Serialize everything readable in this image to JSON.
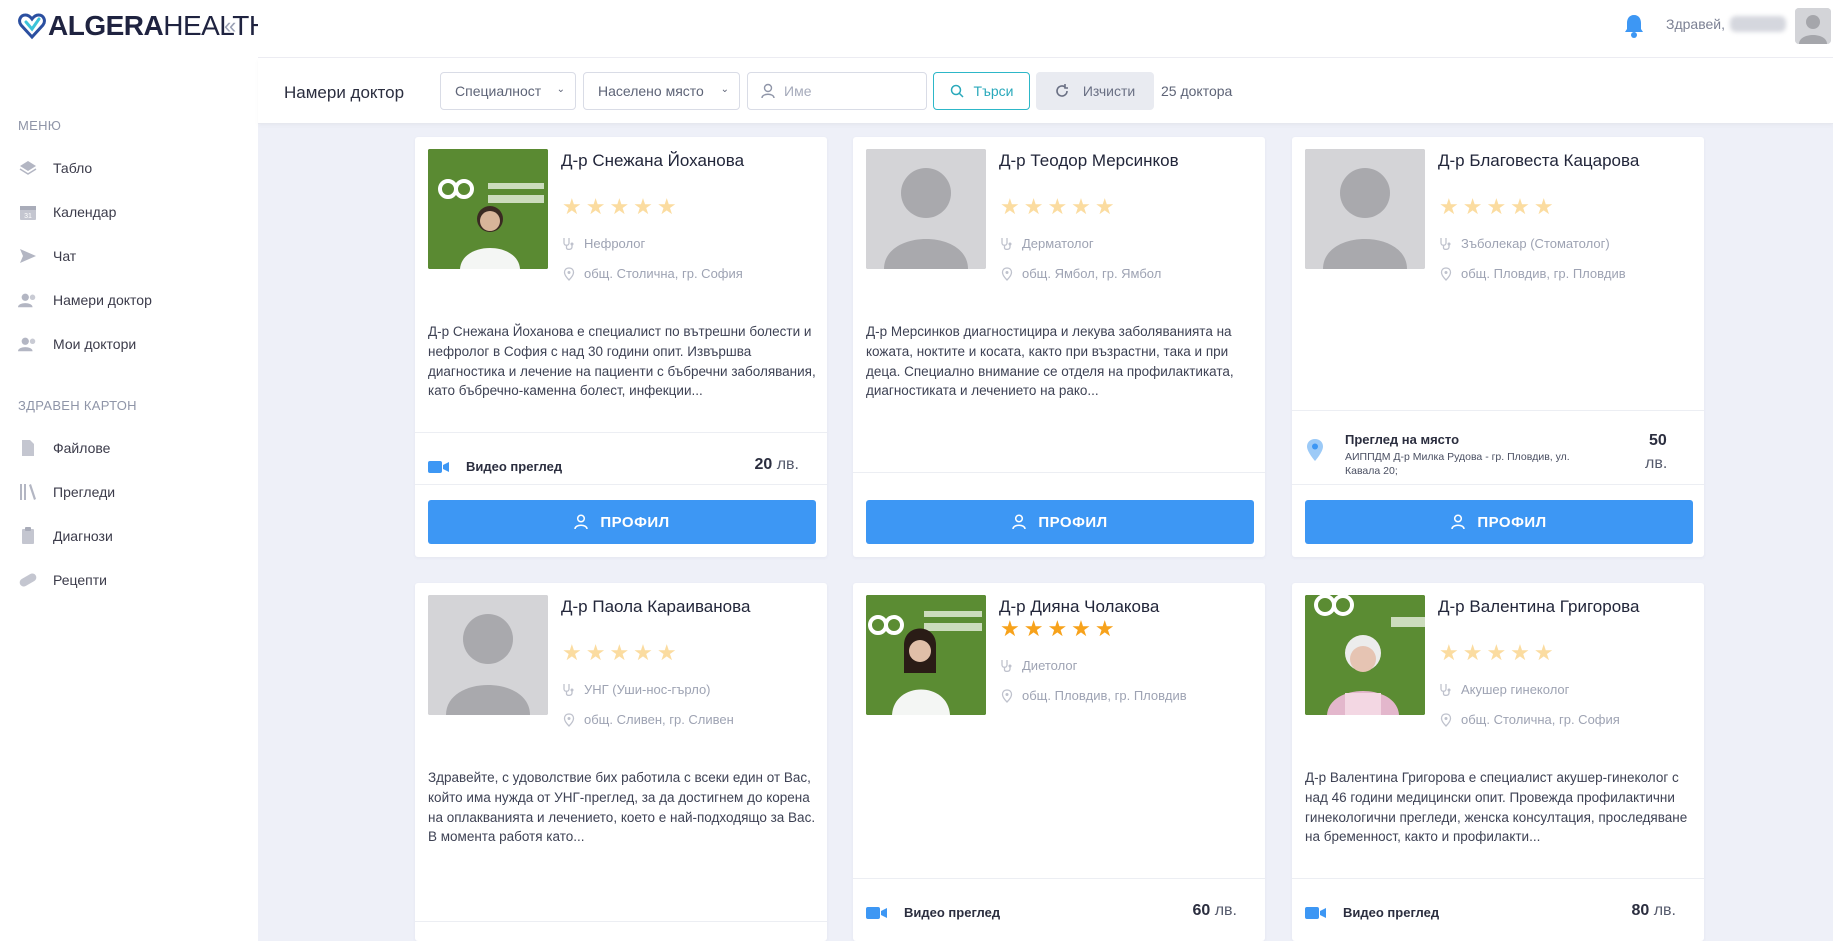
{
  "app": {
    "logo_bold": "ALGERA",
    "logo_light": "HEALTH",
    "collapse": "«"
  },
  "sidebar": {
    "section_menu": "МЕНЮ",
    "section_health": "ЗДРАВЕН КАРТОН",
    "items": [
      {
        "label": "Табло",
        "icon": "dashboard-icon"
      },
      {
        "label": "Календар",
        "icon": "calendar-icon"
      },
      {
        "label": "Чат",
        "icon": "send-icon"
      },
      {
        "label": "Намери доктор",
        "icon": "find-doctor-icon"
      },
      {
        "label": "Мои доктори",
        "icon": "my-doctors-icon"
      },
      {
        "label": "Файлове",
        "icon": "file-icon"
      },
      {
        "label": "Прегледи",
        "icon": "books-icon"
      },
      {
        "label": "Диагнози",
        "icon": "clipboard-icon"
      },
      {
        "label": "Рецепти",
        "icon": "pill-icon"
      }
    ]
  },
  "topbar": {
    "greeting": "Здравей,"
  },
  "filters": {
    "title": "Намери доктор",
    "specialty": "Специалност",
    "city": "Населено място",
    "name_placeholder": "Име",
    "search": "Търси",
    "clear": "Изчисти",
    "count": "25 доктора"
  },
  "colors": {
    "accent": "#3d97f4",
    "star_empty": "#fbdca0",
    "star_filled": "#f7a21b",
    "search_border": "#2db7c8"
  },
  "cards": [
    {
      "name": "Д-р Снежана Йоханова",
      "rating": 0,
      "specialty": "Нефролог",
      "location": "общ. Столична, гр. София",
      "description": "Д-р Снежана Йоханова е специалист по вътрешни болести и нефролог в София с над 30 години опит. Извършва диагностика и лечение на пациенти с бъбречни заболявания, като бъбречно-каменна болест, инфекции...",
      "visit_type": "Видео преглед",
      "price": "20",
      "currency": "лв.",
      "profile": "ПРОФИЛ"
    },
    {
      "name": "Д-р Теодор Мерсинков",
      "rating": 0,
      "specialty": "Дерматолог",
      "location": "общ. Ямбол, гр. Ямбол",
      "description": "Д-р Мерсинков диагностицира и лекува заболяванията на кожата, ноктите и косата, както при възрастни, така и при деца. Специално внимание се отделя на профилактиката, диагностиката и лечението на рако...",
      "profile": "ПРОФИЛ"
    },
    {
      "name": "Д-р Благовеста Кацарова",
      "rating": 0,
      "specialty": "Зъболекар (Стоматолог)",
      "location": "общ. Пловдив, гр. Пловдив",
      "visit_type": "Преглед на място",
      "address": "АИППДМ Д-р Милка Рудова - гр. Пловдив, ул. Кавала 20;",
      "price": "50",
      "currency": "лв.",
      "profile": "ПРОФИЛ"
    },
    {
      "name": "Д-р Паола Караиванова",
      "rating": 0,
      "specialty": "УНГ (Уши-нос-гърло)",
      "location": "общ. Сливен, гр. Сливен",
      "description": "Здравейте, с удоволствие бих работила с всеки един от Вас, който има нужда от УНГ-преглед, за да достигнем до корена на оплакванията и лечението, което е най-подходящо за Вас. В момента работя като..."
    },
    {
      "name": "Д-р Дияна Чолакова",
      "rating": 5,
      "specialty": "Диетолог",
      "location": "общ. Пловдив, гр. Пловдив",
      "visit_type": "Видео преглед",
      "price": "60",
      "currency": "лв."
    },
    {
      "name": "Д-р Валентина Григорова",
      "rating": 0,
      "specialty": "Акушер гинеколог",
      "location": "общ. Столична, гр. София",
      "description": "Д-р Валентина Григорова е специалист акушер-гинеколог с над 46 години медицински опит. Провежда профилактични гинекологични прегледи, женска консултация, проследяване на бременност, както и профилакти...",
      "visit_type": "Видео преглед",
      "price": "80",
      "currency": "лв."
    }
  ]
}
